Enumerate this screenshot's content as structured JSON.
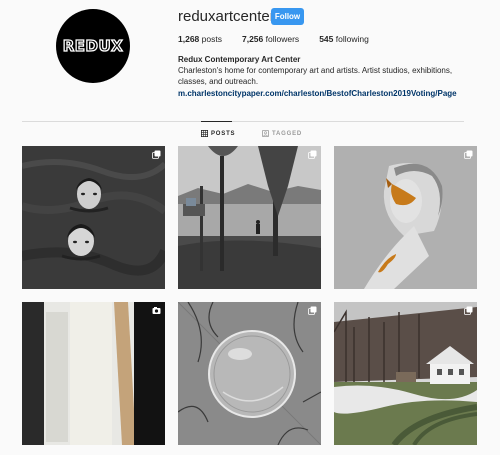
{
  "profile": {
    "username": "reduxartcenter",
    "follow_label": "Follow",
    "avatar_text": "REDUX",
    "posts_count": "1,268",
    "posts_label": "posts",
    "followers_count": "7,256",
    "followers_label": "followers",
    "following_count": "545",
    "following_label": "following",
    "full_name": "Redux Contemporary Art Center",
    "bio": "Charleston's home for contemporary art and artists. Artist studios, exhibitions, classes, and outreach.",
    "link": "m.charlestoncitypaper.com/charleston/BestofCharleston2019Voting/Page"
  },
  "tabs": [
    {
      "label": "POSTS",
      "icon": "grid-icon",
      "active": true
    },
    {
      "label": "TAGGED",
      "icon": "tag-icon",
      "active": false
    }
  ],
  "posts": [
    {
      "subject": "two faces in water",
      "badge": "multiple-photos-icon"
    },
    {
      "subject": "lake with dock and trees",
      "badge": "multiple-photos-icon"
    },
    {
      "subject": "woman with fish",
      "badge": "multiple-photos-icon"
    },
    {
      "subject": "abstract panels",
      "badge": "video-camera-icon"
    },
    {
      "subject": "frozen bubble",
      "badge": "multiple-photos-icon"
    },
    {
      "subject": "farmhouse in snow",
      "badge": "multiple-photos-icon"
    }
  ],
  "colors": {
    "accent": "#3897f0",
    "link": "#003569",
    "background": "#fafafa"
  }
}
